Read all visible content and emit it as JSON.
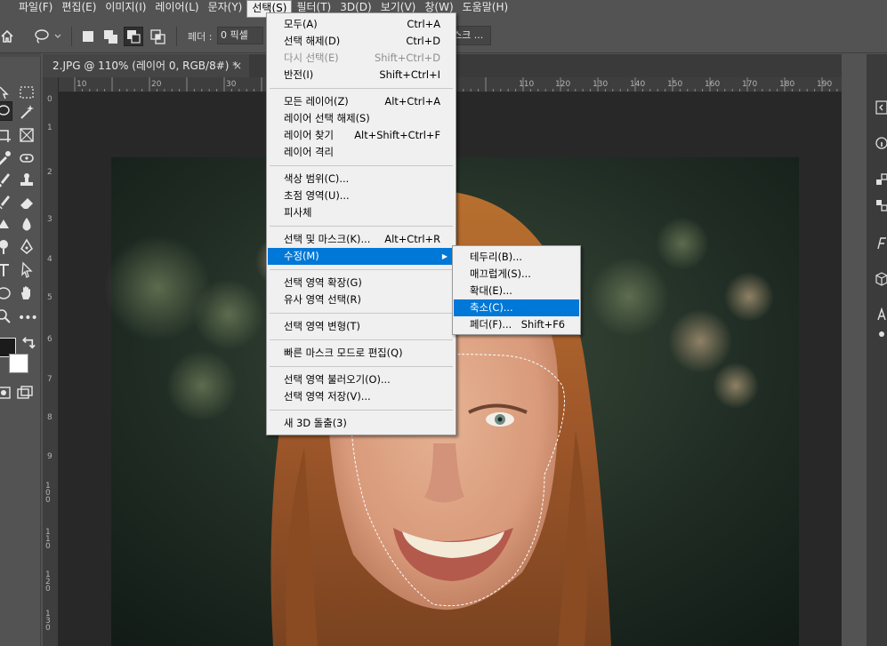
{
  "menubar": {
    "items": [
      "파일(F)",
      "편집(E)",
      "이미지(I)",
      "레이어(L)",
      "문자(Y)",
      "선택(S)",
      "필터(T)",
      "3D(D)",
      "보기(V)",
      "창(W)",
      "도움말(H)"
    ]
  },
  "options": {
    "feather_label": "페더 :",
    "feather_value": "0 픽셀",
    "mask_button": "스크 ..."
  },
  "document": {
    "tab_title": "2.JPG @ 110% (레이어 0, RGB/8#) *",
    "close": "×"
  },
  "ruler": {
    "h_ticks": [
      "10",
      "20",
      "30",
      "110",
      "120",
      "130",
      "140",
      "150",
      "160",
      "170",
      "180",
      "190"
    ],
    "v_ticks": [
      "0",
      "1",
      "2",
      "3",
      "4",
      "5",
      "6",
      "7",
      "8",
      "9",
      "1 0 0",
      "1 1 0",
      "1 2 0",
      "1 3 0"
    ]
  },
  "select_menu": {
    "items": [
      {
        "label": "모두(A)",
        "shortcut": "Ctrl+A"
      },
      {
        "label": "선택 해제(D)",
        "shortcut": "Ctrl+D"
      },
      {
        "label": "다시 선택(E)",
        "shortcut": "Shift+Ctrl+D",
        "disabled": true
      },
      {
        "label": "반전(I)",
        "shortcut": "Shift+Ctrl+I"
      },
      {
        "label": "모든 레이어(Z)",
        "shortcut": "Alt+Ctrl+A"
      },
      {
        "label": "레이어 선택 해제(S)",
        "shortcut": ""
      },
      {
        "label": "레이어 찾기",
        "shortcut": "Alt+Shift+Ctrl+F"
      },
      {
        "label": "레이어 격리",
        "shortcut": ""
      },
      {
        "label": "색상 범위(C)...",
        "shortcut": ""
      },
      {
        "label": "초점 영역(U)...",
        "shortcut": ""
      },
      {
        "label": "피사체",
        "shortcut": ""
      },
      {
        "label": "선택 및 마스크(K)...",
        "shortcut": "Alt+Ctrl+R"
      },
      {
        "label": "수정(M)",
        "shortcut": "",
        "highlighted": true
      },
      {
        "label": "선택 영역 확장(G)",
        "shortcut": ""
      },
      {
        "label": "유사 영역 선택(R)",
        "shortcut": ""
      },
      {
        "label": "선택 영역 변형(T)",
        "shortcut": ""
      },
      {
        "label": "빠른 마스크 모드로 편집(Q)",
        "shortcut": ""
      },
      {
        "label": "선택 영역 불러오기(O)...",
        "shortcut": ""
      },
      {
        "label": "선택 영역 저장(V)...",
        "shortcut": ""
      },
      {
        "label": "새 3D 돌출(3)",
        "shortcut": ""
      }
    ]
  },
  "modify_submenu": {
    "items": [
      {
        "label": "테두리(B)...",
        "shortcut": ""
      },
      {
        "label": "매끄럽게(S)...",
        "shortcut": ""
      },
      {
        "label": "확대(E)...",
        "shortcut": ""
      },
      {
        "label": "축소(C)...",
        "shortcut": "",
        "highlighted": true
      },
      {
        "label": "페더(F)...",
        "shortcut": "Shift+F6"
      }
    ]
  },
  "colors": {
    "highlight": "#0078d7",
    "menu_bg": "#f0f0f0",
    "app_bg": "#535353"
  }
}
